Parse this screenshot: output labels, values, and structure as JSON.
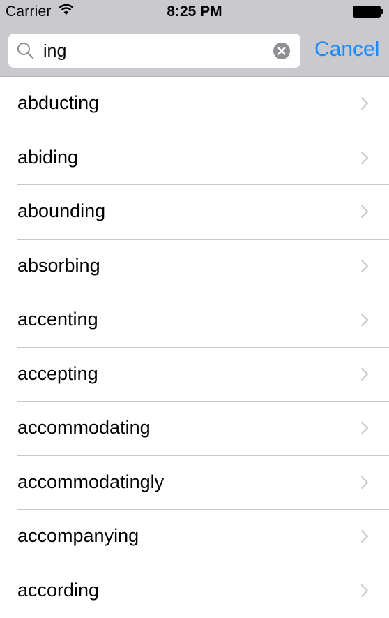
{
  "status_bar": {
    "carrier": "Carrier",
    "time": "8:25 PM",
    "wifi_icon": "wifi-icon",
    "battery_icon": "battery-icon"
  },
  "search": {
    "value": "ing",
    "search_icon": "magnifier-icon",
    "clear_icon": "clear-circle-x-icon",
    "cancel_label": "Cancel"
  },
  "colors": {
    "bar_background": "#c9c9ce",
    "accent": "#1a8cff",
    "separator": "#c8c7cc",
    "chevron": "#c7c7cc"
  },
  "results": [
    {
      "label": "abducting"
    },
    {
      "label": "abiding"
    },
    {
      "label": "abounding"
    },
    {
      "label": "absorbing"
    },
    {
      "label": "accenting"
    },
    {
      "label": "accepting"
    },
    {
      "label": "accommodating"
    },
    {
      "label": "accommodatingly"
    },
    {
      "label": "accompanying"
    },
    {
      "label": "according"
    }
  ]
}
